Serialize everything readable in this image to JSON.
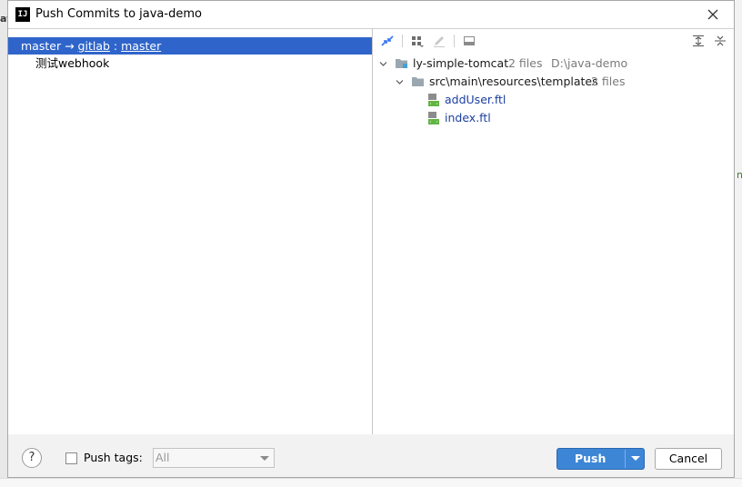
{
  "window": {
    "title": "Push Commits to java-demo",
    "app_icon_text": "IJ",
    "close_icon": "close-icon"
  },
  "left_pane": {
    "branch": {
      "source": "master",
      "arrow": "→",
      "remote": "gitlab",
      "separator": ":",
      "target": "master"
    },
    "commits": [
      "测试webhook"
    ]
  },
  "right_pane": {
    "toolbar_icons": [
      "expand-diff-icon",
      "group-by-icon",
      "edit-icon",
      "preview-diff-icon",
      "expand-all-icon",
      "collapse-all-icon"
    ],
    "tree": {
      "root": {
        "name": "ly-simple-tomcat",
        "count": "2 files",
        "path": "D:\\java-demo"
      },
      "folder": {
        "name": "src\\main\\resources\\templates",
        "count": "2 files"
      },
      "files": [
        "addUser.ftl",
        "index.ftl"
      ]
    }
  },
  "bottom": {
    "help_label": "?",
    "push_tags_label": "Push tags:",
    "push_tags_checked": false,
    "tags_select_value": "All",
    "push_label": "Push",
    "cancel_label": "Cancel"
  },
  "background": {
    "left_fragment": "at",
    "right_fragment": "na"
  },
  "colors": {
    "selection": "#2f65ca",
    "primary_button": "#3d86d6",
    "file_link": "#1b3fa0"
  }
}
